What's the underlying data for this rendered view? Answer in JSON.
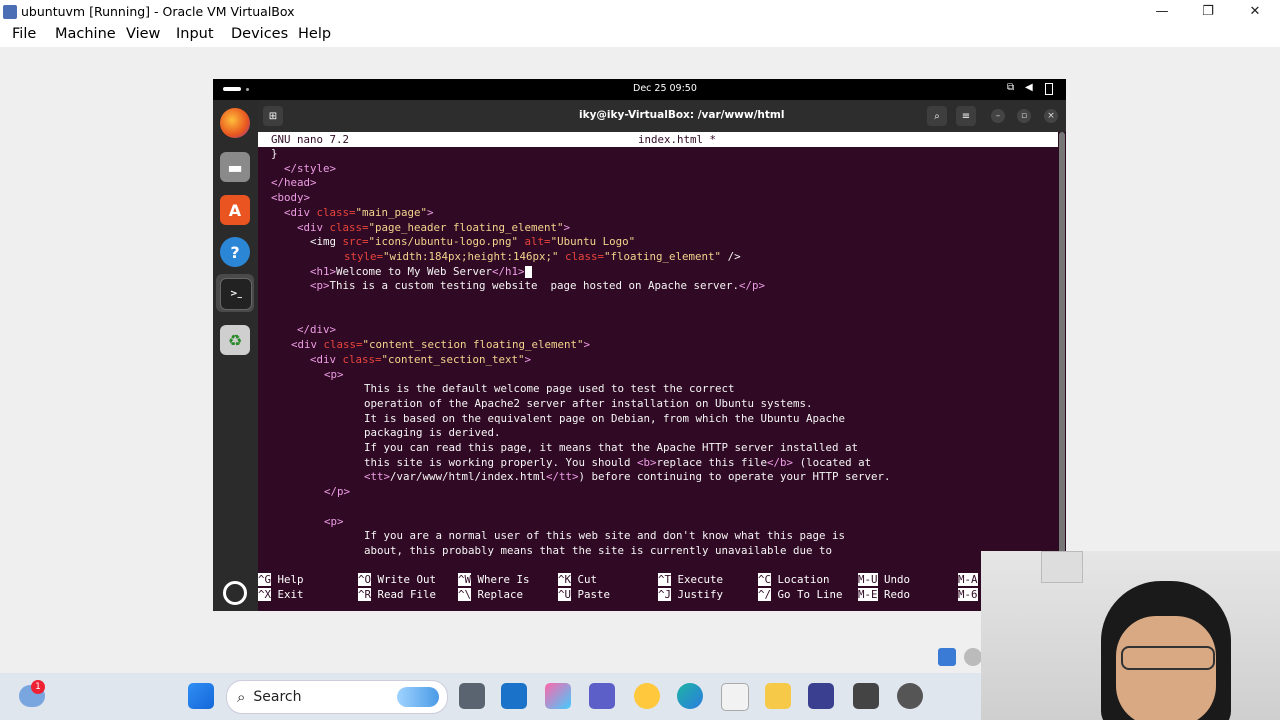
{
  "window": {
    "title": "ubuntuvm [Running] - Oracle VM VirtualBox",
    "minimize": "—",
    "restore": "❐",
    "close": "✕"
  },
  "menu": [
    "File",
    "Machine",
    "View",
    "Input",
    "Devices",
    "Help"
  ],
  "guest": {
    "clock": "Dec 25  09:50",
    "terminal_title": "iky@iky-VirtualBox: /var/www/html"
  },
  "nano": {
    "version": "GNU nano 7.2",
    "filename": "index.html *"
  },
  "code": {
    "l1": "}",
    "l2": "</style>",
    "l3": "</head>",
    "l4": "<body>",
    "l5a": "<div ",
    "l5b": "class=",
    "l5c": "\"main_page\"",
    "l5d": ">",
    "l6a": "<div ",
    "l6b": "class=",
    "l6c": "\"page_header floating_element\"",
    "l6d": ">",
    "l7a": "<img ",
    "l7b": "src=",
    "l7c": "\"icons/ubuntu-logo.png\" ",
    "l7d": "alt=",
    "l7e": "\"Ubuntu Logo\"",
    "l8a": "style=",
    "l8b": "\"width:184px;height:146px;\" ",
    "l8c": "class=",
    "l8d": "\"floating_element\"",
    "l8e": " />",
    "l9a": "<h1>",
    "l9b": "Welcome to My Web Server",
    "l9c": "</h1>",
    "l10a": "<p>",
    "l10b": "This is a custom testing website  page hosted on Apache server.",
    "l10c": "</p>",
    "l13": "</div>",
    "l14a": "<div ",
    "l14b": "class=",
    "l14c": "\"content_section floating_element\"",
    "l14d": ">",
    "l15a": "<div ",
    "l15b": "class=",
    "l15c": "\"content_section_text\"",
    "l15d": ">",
    "l16": "<p>",
    "l17": "This is the default welcome page used to test the correct",
    "l18": "operation of the Apache2 server after installation on Ubuntu systems.",
    "l19": "It is based on the equivalent page on Debian, from which the Ubuntu Apache",
    "l20": "packaging is derived.",
    "l21": "If you can read this page, it means that the Apache HTTP server installed at",
    "l22a": "this site is working properly. You should ",
    "l22b": "<b>",
    "l22c": "replace this file",
    "l22d": "</b>",
    "l22e": " (located at",
    "l23a": "<tt>",
    "l23b": "/var/www/html/index.html",
    "l23c": "</tt>",
    "l23d": ") before continuing to operate your HTTP server.",
    "l24": "</p>",
    "l26": "<p>",
    "l27": "If you are a normal user of this web site and don't know what this page is",
    "l28": "about, this probably means that the site is currently unavailable due to"
  },
  "shortcuts": [
    {
      "k1": "^G",
      "l1": "Help",
      "k2": "^X",
      "l2": "Exit"
    },
    {
      "k1": "^O",
      "l1": "Write Out",
      "k2": "^R",
      "l2": "Read File"
    },
    {
      "k1": "^W",
      "l1": "Where Is",
      "k2": "^\\",
      "l2": "Replace"
    },
    {
      "k1": "^K",
      "l1": "Cut",
      "k2": "^U",
      "l2": "Paste"
    },
    {
      "k1": "^T",
      "l1": "Execute",
      "k2": "^J",
      "l2": "Justify"
    },
    {
      "k1": "^C",
      "l1": "Location",
      "k2": "^/",
      "l2": "Go To Line"
    },
    {
      "k1": "M-U",
      "l1": "Undo",
      "k2": "M-E",
      "l2": "Redo"
    },
    {
      "k1": "M-A",
      "l1": "",
      "k2": "M-6",
      "l2": ""
    }
  ],
  "taskbar": {
    "search_label": "Search",
    "badge": "1"
  },
  "colors": {
    "terminal_bg": "#300a24",
    "tag": "#ee9de6",
    "attr": "#e8443b",
    "string": "#f3d38d"
  }
}
